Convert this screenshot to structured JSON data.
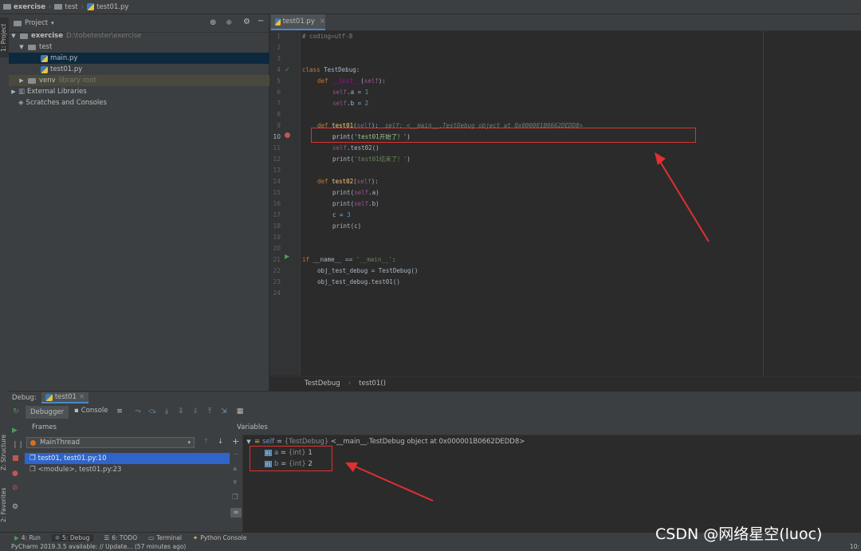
{
  "navbar": {
    "project": "exercise",
    "folder": "test",
    "file": "test01.py"
  },
  "left_strip": {
    "project_tab": "1: Project",
    "structure_tab": "Z: Structure",
    "favorites_tab": "2: Favorites"
  },
  "project_panel": {
    "title": "Project",
    "tree": {
      "root": "exercise",
      "root_path": "D:\\tobetester\\exercise",
      "folder": "test",
      "file1": "main.py",
      "file2": "test01.py",
      "venv": "venv",
      "venv_note": "library root",
      "ext_libs": "External Libraries",
      "scratches": "Scratches and Consoles"
    }
  },
  "editor": {
    "tab": "test01.py",
    "lines": [
      "1",
      "2",
      "3",
      "4",
      "5",
      "6",
      "7",
      "8",
      "9",
      "10",
      "11",
      "12",
      "13",
      "14",
      "15",
      "16",
      "17",
      "18",
      "19",
      "20",
      "21",
      "22",
      "23",
      "24"
    ],
    "code": {
      "l1": "# coding=utf-8",
      "l4_kw": "class ",
      "l4_name": "TestDebug",
      "l4_end": ":",
      "l5_kw": "def ",
      "l5_name": "__init__",
      "l5_open": "(",
      "l5_self": "self",
      "l5_close": "):",
      "l6_self": "self",
      "l6_rest": ".a = ",
      "l6_num": "1",
      "l7_self": "self",
      "l7_rest": ".b = ",
      "l7_num": "2",
      "l9_kw": "def ",
      "l9_name": "test01",
      "l9_open": "(",
      "l9_self": "self",
      "l9_close": "):",
      "l9_hint": "self: <__main__.TestDebug object at 0x000001B0662DEDD8>",
      "l10_fn": "print(",
      "l10_str": "'test01开始了！'",
      "l10_close": ")",
      "l11_self": "self",
      "l11_rest": ".test02()",
      "l12_fn": "print(",
      "l12_str": "'test01结束了！'",
      "l12_close": ")",
      "l14_kw": "def ",
      "l14_name": "test02",
      "l14_open": "(",
      "l14_self": "self",
      "l14_close": "):",
      "l15_a": "print(",
      "l15_self": "self",
      "l15_b": ".a)",
      "l16_a": "print(",
      "l16_self": "self",
      "l16_b": ".b)",
      "l17_a": "c = ",
      "l17_num": "3",
      "l18": "print(c)",
      "l21_kw": "if ",
      "l21_a": "__name__ == ",
      "l21_str": "'__main__'",
      "l21_end": ":",
      "l22": "obj_test_debug = TestDebug()",
      "l23": "obj_test_debug.test01()"
    },
    "breadcrumb": {
      "cls": "TestDebug",
      "method": "test01()"
    }
  },
  "debug": {
    "label": "Debug:",
    "tab": "test01",
    "tabs": {
      "debugger": "Debugger",
      "console": "Console"
    },
    "frames_title": "Frames",
    "thread": "MainThread",
    "frames": {
      "f1": "test01, test01.py:10",
      "f2": "<module>, test01.py:23"
    },
    "variables_title": "Variables",
    "vars": {
      "self_name": "self",
      "self_eq": " = ",
      "self_type": "{TestDebug}",
      "self_val": " <__main__.TestDebug object at 0x000001B0662DEDD8>",
      "a_name": "a",
      "a_eq": " = ",
      "a_type": "{int}",
      "a_val": " 1",
      "b_name": "b",
      "b_eq": " = ",
      "b_type": "{int}",
      "b_val": " 2"
    }
  },
  "bottom_tabs": {
    "run": "4: Run",
    "debug": "5: Debug",
    "todo": "6: TODO",
    "terminal": "Terminal",
    "python_console": "Python Console"
  },
  "status": {
    "text": "PyCharm 2019.3.5 available: // Update... (57 minutes ago)",
    "right": "10:"
  },
  "watermark": "CSDN @网络星空(luoc)"
}
